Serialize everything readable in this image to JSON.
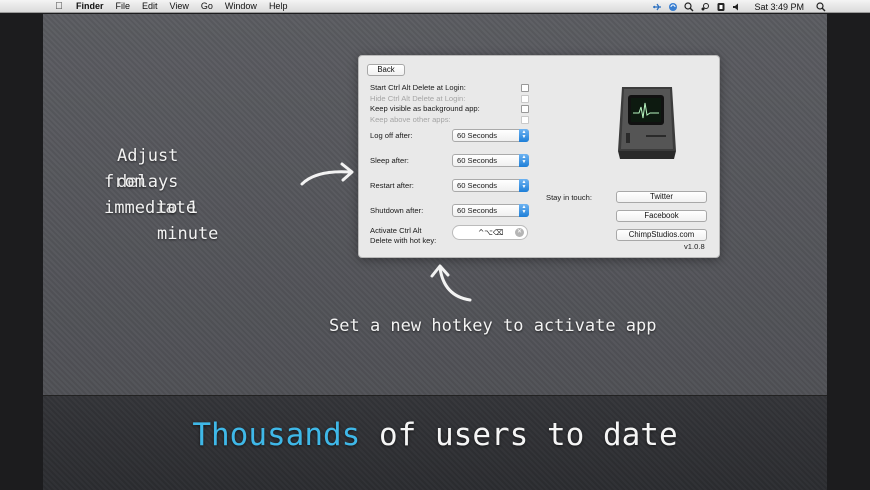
{
  "menubar": {
    "app": "Finder",
    "items": [
      "File",
      "Edit",
      "View",
      "Go",
      "Window",
      "Help"
    ],
    "status_icons": [
      "airplane-icon",
      "sync-icon",
      "search-app-icon",
      "steam-icon",
      "shield-icon",
      "volume-icon"
    ],
    "clock": "Sat 3:49 PM"
  },
  "panel": {
    "back_label": "Back",
    "checkboxes": [
      {
        "label": "Start Ctrl Alt Delete at Login:",
        "enabled": true,
        "checked": false
      },
      {
        "label": "Hide Ctrl Alt Delete at Login:",
        "enabled": false,
        "checked": false
      },
      {
        "label": "Keep visible as background app:",
        "enabled": true,
        "checked": false
      },
      {
        "label": "Keep above other apps:",
        "enabled": false,
        "checked": false
      }
    ],
    "delays": [
      {
        "label": "Log off after:",
        "value": "60 Seconds"
      },
      {
        "label": "Sleep after:",
        "value": "60 Seconds"
      },
      {
        "label": "Restart after:",
        "value": "60 Seconds"
      },
      {
        "label": "Shutdown after:",
        "value": "60 Seconds"
      }
    ],
    "hotkey_label": "Activate Ctrl Alt Delete with hot key:",
    "hotkey_value": "^⌥⌫",
    "stay_label": "Stay in touch:",
    "twitter_label": "Twitter",
    "facebook_label": "Facebook",
    "chimp_label": "ChimpStudios.com",
    "version": "v1.0.8"
  },
  "annotations": {
    "left": [
      "Adjust delays",
      "from immediate",
      "to 1 minute"
    ],
    "bottom": "Set a new hotkey to activate app"
  },
  "tagline": {
    "highlight": "Thousands",
    "rest": " of users to date",
    "highlight_color": "#3fb8e8"
  }
}
